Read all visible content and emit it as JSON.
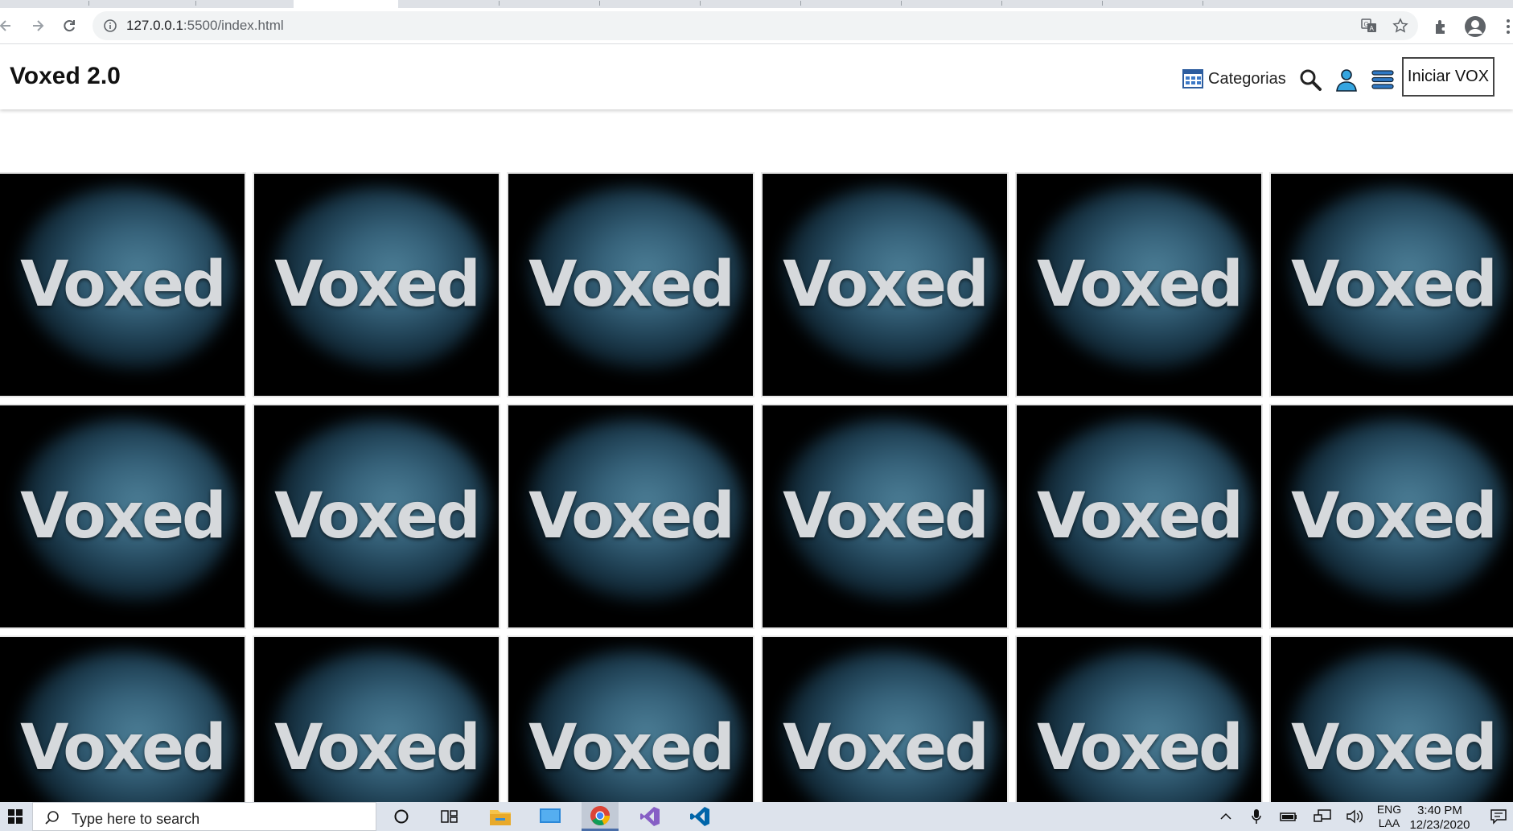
{
  "browser": {
    "url_host": "127.0.0.1",
    "url_path": ":5500/index.html"
  },
  "site": {
    "brand": "Voxed 2.0",
    "nav": {
      "categorias_label": "Categorias",
      "iniciar_label": "Iniciar VOX"
    },
    "cards": [
      {
        "title": "Voxed"
      },
      {
        "title": "Voxed"
      },
      {
        "title": "Voxed"
      },
      {
        "title": "Voxed"
      },
      {
        "title": "Voxed"
      },
      {
        "title": "Voxed"
      },
      {
        "title": "Voxed"
      },
      {
        "title": "Voxed"
      },
      {
        "title": "Voxed"
      },
      {
        "title": "Voxed"
      },
      {
        "title": "Voxed"
      },
      {
        "title": "Voxed"
      },
      {
        "title": "Voxed"
      },
      {
        "title": "Voxed"
      },
      {
        "title": "Voxed"
      },
      {
        "title": "Voxed"
      },
      {
        "title": "Voxed"
      },
      {
        "title": "Voxed"
      }
    ]
  },
  "taskbar": {
    "search_placeholder": "Type here to search",
    "language": "ENG",
    "language_sub": "LAA",
    "time": "3:40 PM",
    "date": "12/23/2020"
  },
  "colors": {
    "card_bg": "#000000",
    "card_glow": "#4c7e96",
    "card_text": "#d6d9dc"
  }
}
